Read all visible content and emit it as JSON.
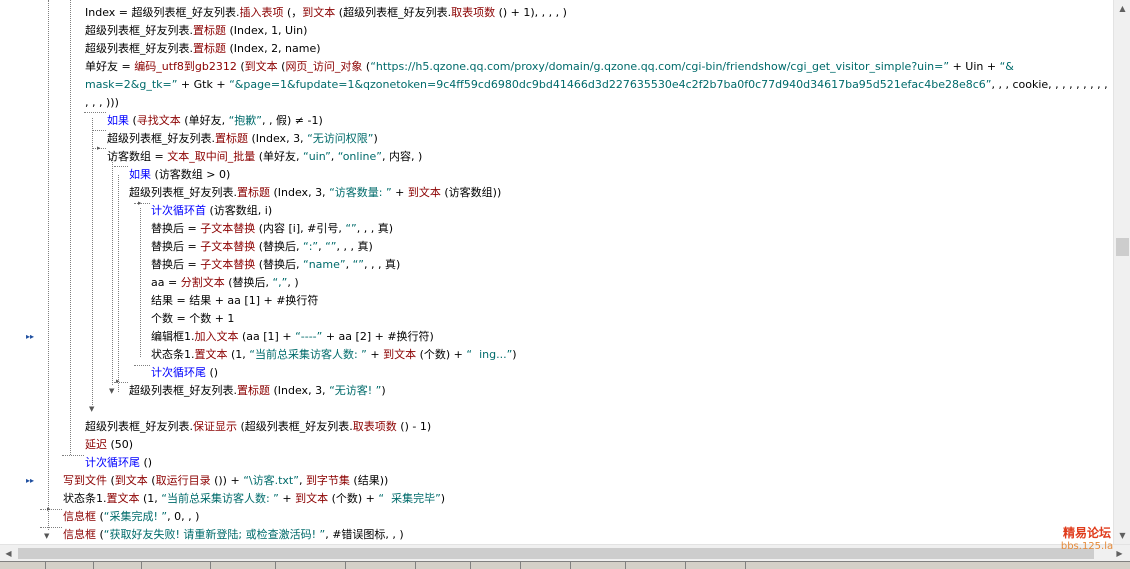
{
  "code_lines": [
    {
      "indent": 85,
      "segments": [
        {
          "t": "Index = ",
          "c": "plain"
        },
        {
          "t": "超级列表框_好友列表.",
          "c": "plain"
        },
        {
          "t": "插入表项",
          "c": "fn"
        },
        {
          "t": " (，",
          "c": "plain"
        },
        {
          "t": "到文本",
          "c": "fn"
        },
        {
          "t": " (超级列表框_好友列表.",
          "c": "plain"
        },
        {
          "t": "取表项数",
          "c": "fn"
        },
        {
          "t": " () + 1), , , , )",
          "c": "plain"
        }
      ]
    },
    {
      "indent": 85,
      "segments": [
        {
          "t": "超级列表框_好友列表.",
          "c": "plain"
        },
        {
          "t": "置标题",
          "c": "fn"
        },
        {
          "t": " (Index, 1, Uin)",
          "c": "plain"
        }
      ]
    },
    {
      "indent": 85,
      "segments": [
        {
          "t": "超级列表框_好友列表.",
          "c": "plain"
        },
        {
          "t": "置标题",
          "c": "fn"
        },
        {
          "t": " (Index, 2, name)",
          "c": "plain"
        }
      ]
    },
    {
      "indent": 85,
      "segments": [
        {
          "t": "单好友 = ",
          "c": "plain"
        },
        {
          "t": "编码_utf8到gb2312",
          "c": "fn"
        },
        {
          "t": " (",
          "c": "plain"
        },
        {
          "t": "到文本",
          "c": "fn"
        },
        {
          "t": " (",
          "c": "plain"
        },
        {
          "t": "网页_访问_对象",
          "c": "fn"
        },
        {
          "t": " (",
          "c": "plain"
        },
        {
          "t": "“https://h5.qzone.qq.com/proxy/domain/g.qzone.qq.com/cgi-bin/friendshow/cgi_get_visitor_simple?uin=”",
          "c": "str"
        },
        {
          "t": " + Uin + ",
          "c": "plain"
        },
        {
          "t": "“&",
          "c": "str"
        }
      ]
    },
    {
      "indent": 85,
      "segments": [
        {
          "t": "mask=2&g_tk=”",
          "c": "str"
        },
        {
          "t": " + Gtk + ",
          "c": "plain"
        },
        {
          "t": "“&page=1&fupdate=1&qzonetoken=9c4ff59cd6980dc9bd41466d3d227635530e4c2f2b7ba0f0c77d940d34617ba95d521efac4be28e8c6”",
          "c": "str"
        },
        {
          "t": ", , , cookie, , , , , , , , ,",
          "c": "plain"
        }
      ]
    },
    {
      "indent": 85,
      "segments": [
        {
          "t": ", , , )))",
          "c": "plain"
        }
      ]
    },
    {
      "indent": 107,
      "segments": [
        {
          "t": "如果",
          "c": "kw"
        },
        {
          "t": " (",
          "c": "plain"
        },
        {
          "t": "寻找文本",
          "c": "fn"
        },
        {
          "t": " (单好友, ",
          "c": "plain"
        },
        {
          "t": "“抱歉”",
          "c": "str"
        },
        {
          "t": ", , 假) ≠ -1)",
          "c": "plain"
        }
      ]
    },
    {
      "indent": 107,
      "segments": [
        {
          "t": "超级列表框_好友列表.",
          "c": "plain"
        },
        {
          "t": "置标题",
          "c": "fn"
        },
        {
          "t": " (Index, 3, ",
          "c": "plain"
        },
        {
          "t": "“无访问权限”",
          "c": "str"
        },
        {
          "t": ")",
          "c": "plain"
        }
      ]
    },
    {
      "indent": 107,
      "segments": [
        {
          "t": "访客数组 = ",
          "c": "plain"
        },
        {
          "t": "文本_取中间_批量",
          "c": "fn"
        },
        {
          "t": " (单好友, ",
          "c": "plain"
        },
        {
          "t": "“uin”",
          "c": "str"
        },
        {
          "t": ", ",
          "c": "plain"
        },
        {
          "t": "“online”",
          "c": "str"
        },
        {
          "t": ", 内容, )",
          "c": "plain"
        }
      ]
    },
    {
      "indent": 129,
      "segments": [
        {
          "t": "如果",
          "c": "kw"
        },
        {
          "t": " (访客数组 > 0)",
          "c": "plain"
        }
      ]
    },
    {
      "indent": 129,
      "segments": [
        {
          "t": "超级列表框_好友列表.",
          "c": "plain"
        },
        {
          "t": "置标题",
          "c": "fn"
        },
        {
          "t": " (Index, 3, ",
          "c": "plain"
        },
        {
          "t": "“访客数量: ”",
          "c": "str"
        },
        {
          "t": " + ",
          "c": "plain"
        },
        {
          "t": "到文本",
          "c": "fn"
        },
        {
          "t": " (访客数组))",
          "c": "plain"
        }
      ]
    },
    {
      "indent": 151,
      "segments": [
        {
          "t": "计次循环首",
          "c": "kw"
        },
        {
          "t": " (访客数组, i)",
          "c": "plain"
        }
      ]
    },
    {
      "indent": 151,
      "segments": [
        {
          "t": "替换后 = ",
          "c": "plain"
        },
        {
          "t": "子文本替换",
          "c": "fn"
        },
        {
          "t": " (内容 [i], #引号, ",
          "c": "plain"
        },
        {
          "t": "“”",
          "c": "str"
        },
        {
          "t": ", , , 真)",
          "c": "plain"
        }
      ]
    },
    {
      "indent": 151,
      "segments": [
        {
          "t": "替换后 = ",
          "c": "plain"
        },
        {
          "t": "子文本替换",
          "c": "fn"
        },
        {
          "t": " (替换后, ",
          "c": "plain"
        },
        {
          "t": "“:”",
          "c": "str"
        },
        {
          "t": ", ",
          "c": "plain"
        },
        {
          "t": "“”",
          "c": "str"
        },
        {
          "t": ", , , 真)",
          "c": "plain"
        }
      ]
    },
    {
      "indent": 151,
      "segments": [
        {
          "t": "替换后 = ",
          "c": "plain"
        },
        {
          "t": "子文本替换",
          "c": "fn"
        },
        {
          "t": " (替换后, ",
          "c": "plain"
        },
        {
          "t": "“name”",
          "c": "str"
        },
        {
          "t": ", ",
          "c": "plain"
        },
        {
          "t": "“”",
          "c": "str"
        },
        {
          "t": ", , , 真)",
          "c": "plain"
        }
      ]
    },
    {
      "indent": 151,
      "segments": [
        {
          "t": "aa = ",
          "c": "plain"
        },
        {
          "t": "分割文本",
          "c": "fn"
        },
        {
          "t": " (替换后, ",
          "c": "plain"
        },
        {
          "t": "“,”",
          "c": "str"
        },
        {
          "t": ", )",
          "c": "plain"
        }
      ]
    },
    {
      "indent": 151,
      "segments": [
        {
          "t": "结果 = 结果 + aa [1] + #换行符",
          "c": "plain"
        }
      ]
    },
    {
      "indent": 151,
      "segments": [
        {
          "t": "个数 = 个数 + 1",
          "c": "plain"
        }
      ]
    },
    {
      "indent": 151,
      "segments": [
        {
          "t": "编辑框1.",
          "c": "plain"
        },
        {
          "t": "加入文本",
          "c": "fn"
        },
        {
          "t": " (aa [1] + ",
          "c": "plain"
        },
        {
          "t": "“----”",
          "c": "str"
        },
        {
          "t": " + aa [2] + #换行符)",
          "c": "plain"
        }
      ]
    },
    {
      "indent": 151,
      "segments": [
        {
          "t": "状态条1.",
          "c": "plain"
        },
        {
          "t": "置文本",
          "c": "fn"
        },
        {
          "t": " (1, ",
          "c": "plain"
        },
        {
          "t": "“当前总采集访客人数: ”",
          "c": "str"
        },
        {
          "t": " + ",
          "c": "plain"
        },
        {
          "t": "到文本",
          "c": "fn"
        },
        {
          "t": " (个数) + ",
          "c": "plain"
        },
        {
          "t": "“  ing...”",
          "c": "str"
        },
        {
          "t": ")",
          "c": "plain"
        }
      ]
    },
    {
      "indent": 151,
      "segments": [
        {
          "t": "计次循环尾",
          "c": "kw"
        },
        {
          "t": " ()",
          "c": "plain"
        }
      ]
    },
    {
      "indent": 129,
      "segments": [
        {
          "t": "超级列表框_好友列表.",
          "c": "plain"
        },
        {
          "t": "置标题",
          "c": "fn"
        },
        {
          "t": " (Index, 3, ",
          "c": "plain"
        },
        {
          "t": "“无访客! ”",
          "c": "str"
        },
        {
          "t": ")",
          "c": "plain"
        }
      ]
    },
    {
      "indent": 85,
      "segments": []
    },
    {
      "indent": 85,
      "segments": [
        {
          "t": "超级列表框_好友列表.",
          "c": "plain"
        },
        {
          "t": "保证显示",
          "c": "fn"
        },
        {
          "t": " (超级列表框_好友列表.",
          "c": "plain"
        },
        {
          "t": "取表项数",
          "c": "fn"
        },
        {
          "t": " () - 1)",
          "c": "plain"
        }
      ]
    },
    {
      "indent": 85,
      "segments": [
        {
          "t": "延迟",
          "c": "fn"
        },
        {
          "t": " (50)",
          "c": "plain"
        }
      ]
    },
    {
      "indent": 85,
      "segments": [
        {
          "t": "计次循环尾",
          "c": "kw"
        },
        {
          "t": " ()",
          "c": "plain"
        }
      ]
    },
    {
      "indent": 63,
      "segments": [
        {
          "t": "写到文件",
          "c": "fn"
        },
        {
          "t": " (",
          "c": "plain"
        },
        {
          "t": "到文本",
          "c": "fn"
        },
        {
          "t": " (",
          "c": "plain"
        },
        {
          "t": "取运行目录",
          "c": "fn"
        },
        {
          "t": " ()) + ",
          "c": "plain"
        },
        {
          "t": "“\\访客.txt”",
          "c": "str"
        },
        {
          "t": ", ",
          "c": "plain"
        },
        {
          "t": "到字节集",
          "c": "fn"
        },
        {
          "t": " (结果))",
          "c": "plain"
        }
      ]
    },
    {
      "indent": 63,
      "segments": [
        {
          "t": "状态条1.",
          "c": "plain"
        },
        {
          "t": "置文本",
          "c": "fn"
        },
        {
          "t": " (1, ",
          "c": "plain"
        },
        {
          "t": "“当前总采集访客人数: ”",
          "c": "str"
        },
        {
          "t": " + ",
          "c": "plain"
        },
        {
          "t": "到文本",
          "c": "fn"
        },
        {
          "t": " (个数) + ",
          "c": "plain"
        },
        {
          "t": "“  采集完毕”",
          "c": "str"
        },
        {
          "t": ")",
          "c": "plain"
        }
      ]
    },
    {
      "indent": 63,
      "segments": [
        {
          "t": "信息框",
          "c": "fn"
        },
        {
          "t": " (",
          "c": "plain"
        },
        {
          "t": "“采集完成! ”",
          "c": "str"
        },
        {
          "t": ", 0, , )",
          "c": "plain"
        }
      ]
    },
    {
      "indent": 63,
      "segments": [
        {
          "t": "信息框",
          "c": "fn"
        },
        {
          "t": " (",
          "c": "plain"
        },
        {
          "t": "“获取好友失败! 请重新登陆; 或检查激活码! ”",
          "c": "str"
        },
        {
          "t": ", #错误图标, , )",
          "c": "plain"
        }
      ]
    }
  ],
  "breakpoint_lines": [
    18,
    26
  ],
  "watermark": {
    "line1": "精易论坛",
    "line2": "bbs.125.la"
  },
  "colors": {
    "keyword": "#0000ff",
    "function": "#8b0000",
    "string": "#006b6b",
    "text": "#000000"
  }
}
